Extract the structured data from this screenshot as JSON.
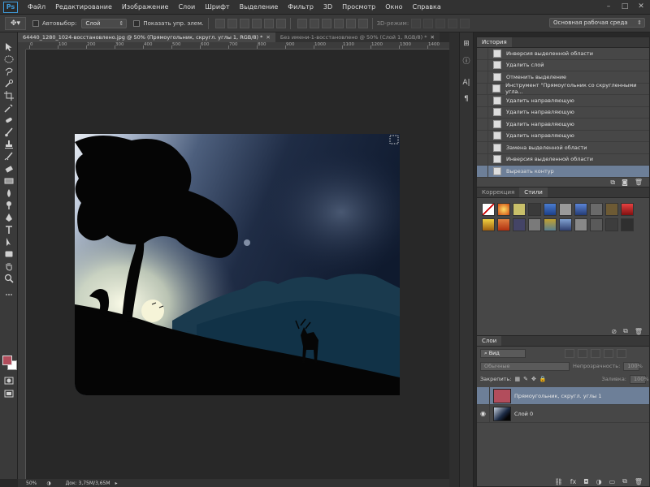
{
  "app": {
    "logo": "Ps"
  },
  "menu": [
    "Файл",
    "Редактирование",
    "Изображение",
    "Слои",
    "Шрифт",
    "Выделение",
    "Фильтр",
    "3D",
    "Просмотр",
    "Окно",
    "Справка"
  ],
  "window_controls": [
    "–",
    "□",
    "✕"
  ],
  "options": {
    "autoselect_label": "Автовыбор:",
    "autoselect_value": "Слой",
    "show_controls_label": "Показать упр. элем.",
    "mode3d_label": "3D-режим:",
    "workspace": "Основная рабочая среда"
  },
  "tabs": [
    {
      "label": "64440_1280_1024-восстановлено.jpg @ 50% (Прямоугольник, скругл. углы 1, RGB/8) *",
      "active": true
    },
    {
      "label": "Без имени-1-восстановлено @ 50% (Слой 1, RGB/8) *",
      "active": false
    }
  ],
  "ruler_labels": [
    "0",
    "100",
    "200",
    "300",
    "400",
    "500",
    "600",
    "700",
    "800",
    "900",
    "1000",
    "1100",
    "1200",
    "1300",
    "1400"
  ],
  "status": {
    "zoom": "50%",
    "doc": "Док: 3,75M/3,65M"
  },
  "colors": {
    "foreground": "#b24d5c",
    "background": "#ffffff",
    "selection": "#6d7f98"
  },
  "history": {
    "tab": "История",
    "items": [
      "Инверсия выделенной области",
      "Удалить слой",
      "Отменить выделение",
      "Инструмент \"Прямоугольник со скругленными угла...",
      "Удалить направляющую",
      "Удалить направляющую",
      "Удалить направляющую",
      "Удалить направляющую",
      "Замена выделенной области",
      "Инверсия выделенной области",
      "Вырезать контур"
    ],
    "selected_index": 10
  },
  "adjust": {
    "tab_correction": "Коррекция",
    "tab_styles": "Стили"
  },
  "layers": {
    "tab": "Слои",
    "filter": "Вид",
    "blend": "Обычные",
    "opacity_label": "Непрозрачность:",
    "opacity": "100%",
    "lock_label": "Закрепить:",
    "fill_label": "Заливка:",
    "fill": "100%",
    "items": [
      {
        "name": "Прямоугольник, скругл. углы 1",
        "selected": true,
        "visible": false
      },
      {
        "name": "Слой 0",
        "selected": false,
        "visible": true
      }
    ]
  }
}
